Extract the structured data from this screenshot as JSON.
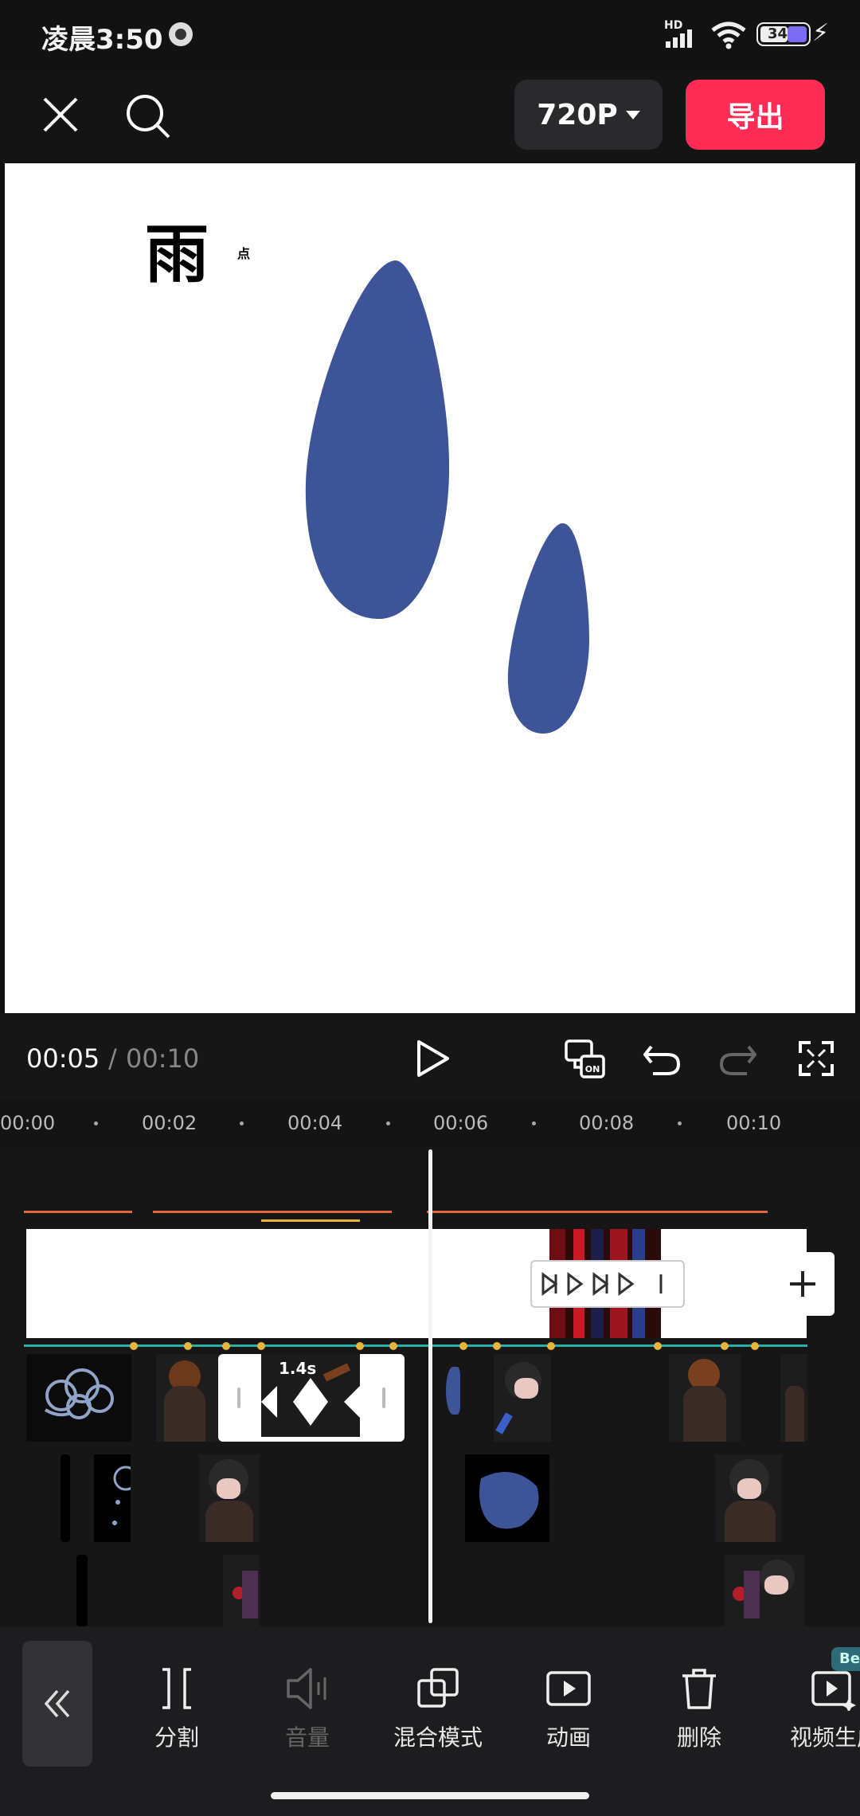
{
  "status_bar": {
    "time": "凌晨3:50",
    "network": "HD",
    "battery": "34"
  },
  "top_bar": {
    "resolution": "720P",
    "export_label": "导出"
  },
  "preview": {
    "title_char": "雨",
    "small_char": "点",
    "drop_color": "#3d5499"
  },
  "playback": {
    "current_time": "00:05",
    "separator": "/",
    "total_time": "00:10"
  },
  "ruler": {
    "ticks": [
      "00:00",
      "00:02",
      "00:04",
      "00:06",
      "00:08",
      "00:10"
    ]
  },
  "timeline": {
    "selected_clip_duration": "1.4s",
    "accent_orange": "#e0673a",
    "accent_yellow": "#e7b53c",
    "accent_teal": "#2bb0a8"
  },
  "toolbar": {
    "items": [
      {
        "label": "分割",
        "icon": "split-icon",
        "enabled": true
      },
      {
        "label": "音量",
        "icon": "volume-icon",
        "enabled": false
      },
      {
        "label": "混合模式",
        "icon": "blend-mode-icon",
        "enabled": true
      },
      {
        "label": "动画",
        "icon": "animation-icon",
        "enabled": true
      },
      {
        "label": "删除",
        "icon": "delete-icon",
        "enabled": true
      },
      {
        "label": "视频生成",
        "icon": "video-generate-icon",
        "enabled": true
      }
    ],
    "badge": "Be"
  }
}
